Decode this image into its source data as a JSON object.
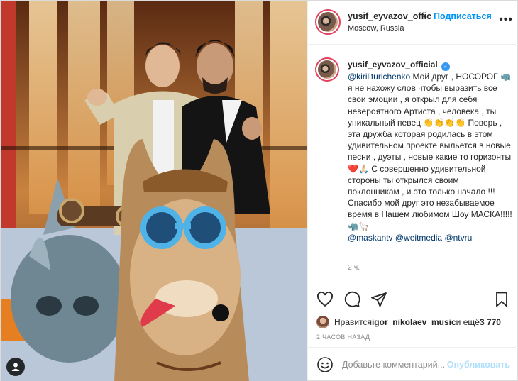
{
  "post": {
    "header": {
      "username": "yusif_eyvazov_offic",
      "separator": "•",
      "follow_label": "Подписаться",
      "location": "Moscow, Russia",
      "more_icon": "more-horizontal-icon"
    },
    "caption": {
      "username": "yusif_eyvazov_official",
      "verified_icon": "verified-badge-icon",
      "mention_1": "@kirillturichenko",
      "text_1": " Мой друг , НОСОРОГ 🦏 я не нахожу слов чтобы выразить все свои эмоции , я открыл для себя невероятного Артиста , человека , ты уникальный певец 👏👏👏👏 Поверь , эта дружба которая родилась в этом удивительном проекте выльется в новые песни , дуэты , новые какие то горизонты ❤️🙏🏻 С совершенно удивительной стороны ты открылся своим поклонникам , и это только начало !!! Спасибо мой друг это незабываемое время в Нашем любимом Шоу МАСКА!!!!! 🦏🦙",
      "mention_2": "@maskantv",
      "mention_3": "@weitmedia",
      "mention_4": "@ntvru",
      "time": "2 ч."
    },
    "actions": {
      "like_icon": "heart-icon",
      "comment_icon": "comment-icon",
      "share_icon": "send-icon",
      "save_icon": "bookmark-icon"
    },
    "likes": {
      "prefix": "Нравится ",
      "user": "igor_nikolaev_music",
      "middle": " и ещё ",
      "count": "3 770"
    },
    "posted_ago": "2 ЧАСОВ НАЗАД",
    "comment": {
      "emoji_icon": "emoji-icon",
      "placeholder": "Добавьте комментарий...",
      "publish_label": "Опубликовать"
    },
    "photo": {
      "tag_icon": "user-tag-icon"
    },
    "colors": {
      "accent": "#0095f6",
      "publish_disabled": "#b2dffc",
      "mention": "#00376b",
      "verified": "#3897f0"
    }
  }
}
